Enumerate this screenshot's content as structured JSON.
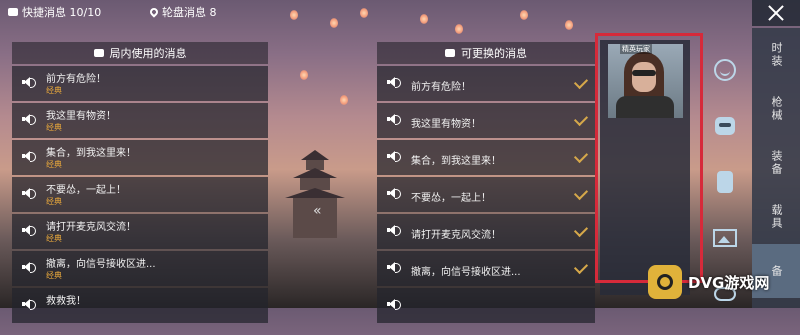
{
  "topbar": {
    "quick_tab": "快捷消息 10/10",
    "wheel_tab": "轮盘消息 8"
  },
  "left_panel": {
    "title": "局内使用的消息",
    "items": [
      {
        "text": "前方有危险！",
        "tag": "经典"
      },
      {
        "text": "我这里有物资！",
        "tag": "经典"
      },
      {
        "text": "集合，到我这里来！",
        "tag": "经典"
      },
      {
        "text": "不要怂，一起上！",
        "tag": "经典"
      },
      {
        "text": "请打开麦克风交流！",
        "tag": "经典"
      },
      {
        "text": "撤离，向信号接收区进...",
        "tag": "经典"
      },
      {
        "text": "救救我！",
        "tag": ""
      }
    ]
  },
  "right_panel": {
    "title": "可更换的消息",
    "items": [
      {
        "text": "前方有危险！"
      },
      {
        "text": "我这里有物资！"
      },
      {
        "text": "集合，到我这里来！"
      },
      {
        "text": "不要怂，一起上！"
      },
      {
        "text": "请打开麦克风交流！"
      },
      {
        "text": "撤离，向信号接收区进..."
      },
      {
        "text": ""
      }
    ]
  },
  "character": {
    "name": "精英玩家"
  },
  "categories": [
    "时装",
    "枪械",
    "装备",
    "载具",
    "备"
  ],
  "active_category": 4,
  "watermark": "DVG游戏网",
  "colors": {
    "accent_gold": "#e0a33c",
    "highlight_red": "#d62a3a"
  }
}
